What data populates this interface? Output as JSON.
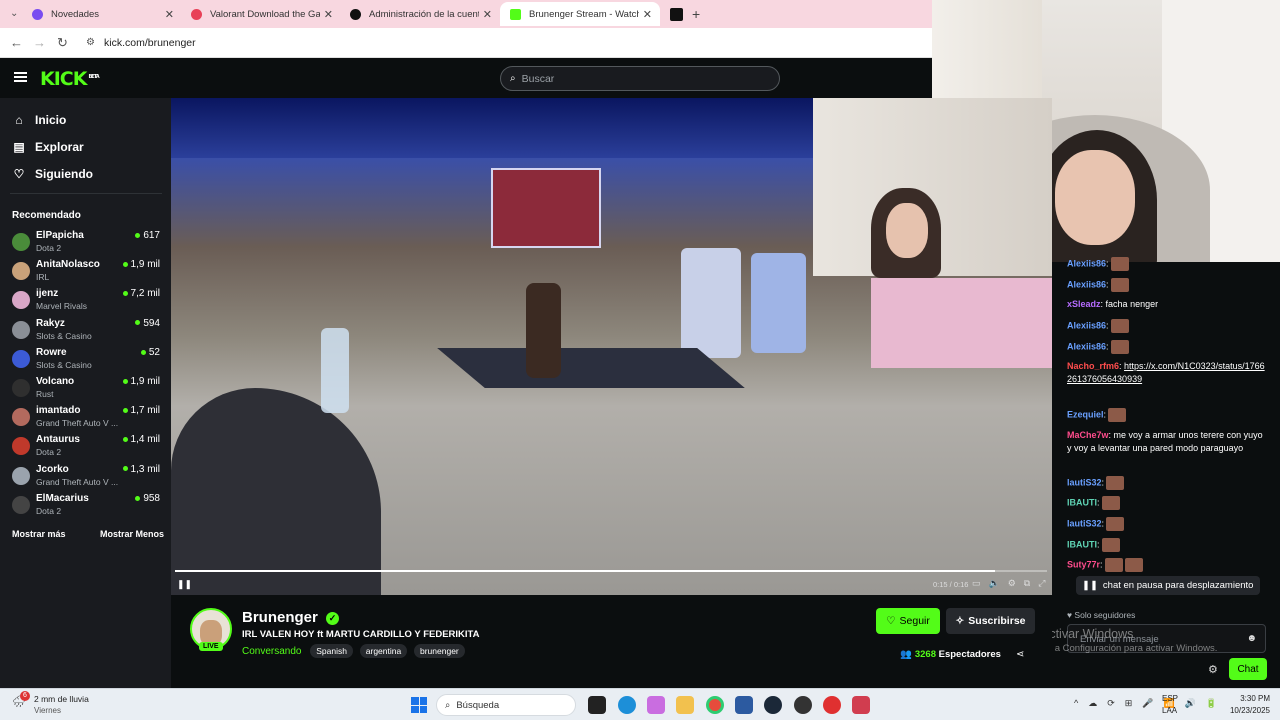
{
  "browser": {
    "tabs": [
      {
        "title": "Novedades",
        "fav": "#7a4cf0"
      },
      {
        "title": "Valorant Download the Game",
        "fav": "#e84057"
      },
      {
        "title": "Administración de la cuenta de",
        "fav": "#111111"
      },
      {
        "title": "Brunenger Stream - Watch Live",
        "fav": "#53fc18"
      },
      {
        "title": "",
        "fav": "#111111"
      }
    ],
    "url": "kick.com/brunenger"
  },
  "header": {
    "logo": "KICK",
    "beta": "BETA",
    "search_placeholder": "Buscar"
  },
  "sidebar": {
    "nav": [
      {
        "label": "Inicio",
        "icon": "home-icon"
      },
      {
        "label": "Explorar",
        "icon": "explore-icon"
      },
      {
        "label": "Siguiendo",
        "icon": "heart-icon"
      }
    ],
    "recommended_title": "Recomendado",
    "channels": [
      {
        "name": "ElPapicha",
        "game": "Dota 2",
        "viewers": "617",
        "color": "#4a8c3a"
      },
      {
        "name": "AnitaNolasco",
        "game": "IRL",
        "viewers": "1,9 mil",
        "color": "#c9a27a"
      },
      {
        "name": "ijenz",
        "game": "Marvel Rivals",
        "viewers": "7,2 mil",
        "color": "#d9a7c7"
      },
      {
        "name": "Rakyz",
        "game": "Slots & Casino",
        "viewers": "594",
        "color": "#8a8f96"
      },
      {
        "name": "Rowre",
        "game": "Slots & Casino",
        "viewers": "52",
        "color": "#3c5bd6"
      },
      {
        "name": "Volcano",
        "game": "Rust",
        "viewers": "1,9 mil",
        "color": "#2f2f2f"
      },
      {
        "name": "imantado",
        "game": "Grand Theft Auto V ...",
        "viewers": "1,7 mil",
        "color": "#b36a5e"
      },
      {
        "name": "Antaurus",
        "game": "Dota 2",
        "viewers": "1,4 mil",
        "color": "#c0392b"
      },
      {
        "name": "Jcorko",
        "game": "Grand Theft Auto V ...",
        "viewers": "1,3 mil",
        "color": "#9aa3ad"
      },
      {
        "name": "ElMacarius",
        "game": "Dota 2",
        "viewers": "958",
        "color": "#444"
      }
    ],
    "show_more": "Mostrar más",
    "show_less": "Mostrar Menos"
  },
  "player": {
    "time": "0:15 / 0:16",
    "progress": 0.94
  },
  "channel": {
    "name": "Brunenger",
    "live_badge": "LIVE",
    "title": "IRL VALEN  HOY ft MARTU CARDILLO Y FEDERIKITA",
    "category": "Conversando",
    "tags": [
      "Spanish",
      "argentina",
      "brunenger"
    ],
    "follow": "Seguir",
    "subscribe": "Suscribirse",
    "viewers": "3268",
    "viewers_label": "Espectadores"
  },
  "chat": {
    "messages": [
      {
        "user": "Alexiis86",
        "color": "#6aa0ff",
        "text": "",
        "emotes": 1
      },
      {
        "user": "Alexiis86",
        "color": "#6aa0ff",
        "text": "",
        "emotes": 1
      },
      {
        "user": "xSleadz",
        "color": "#b66cff",
        "text": "facha nenger",
        "emotes": 0
      },
      {
        "user": "Alexiis86",
        "color": "#6aa0ff",
        "text": "",
        "emotes": 1
      },
      {
        "user": "Alexiis86",
        "color": "#6aa0ff",
        "text": "",
        "emotes": 1
      },
      {
        "user": "Nacho_rfm6",
        "color": "#ff4d4d",
        "text": "https://x.com/N1C0323/status/1766261376056430939",
        "emotes": 0
      },
      {
        "user": "Ezequiel",
        "color": "#6aa0ff",
        "text": "",
        "emotes": 1
      },
      {
        "user": "MaChe7w",
        "color": "#ff4d8d",
        "text": "me voy a armar unos terere con yuyo y voy a levantar una pared modo paraguayo",
        "emotes": 0
      },
      {
        "user": "lautiS32",
        "color": "#6aa0ff",
        "text": "",
        "emotes": 1
      },
      {
        "user": "IBAUTI",
        "color": "#5fd3b4",
        "text": "",
        "emotes": 1
      },
      {
        "user": "lautiS32",
        "color": "#6aa0ff",
        "text": "",
        "emotes": 1
      },
      {
        "user": "IBAUTI",
        "color": "#5fd3b4",
        "text": "",
        "emotes": 1
      },
      {
        "user": "Suty77r",
        "color": "#ff4d8d",
        "text": "",
        "emotes": 2
      }
    ],
    "paused": "chat en pausa para desplazamiento",
    "followers_only": "Solo seguidores",
    "input_placeholder": "Enviar un mensaje",
    "send": "Chat"
  },
  "watermark": {
    "line1": "Activar Windows",
    "line2": "Ve a Configuración para activar Windows."
  },
  "taskbar": {
    "weather_temp": "2 mm de lluvia",
    "weather_day": "Viernes",
    "weather_badge": "6",
    "search": "Búsqueda",
    "lang": "ESP",
    "lang2": "LAA",
    "time": "3:30 PM",
    "date": "10/23/2025"
  }
}
